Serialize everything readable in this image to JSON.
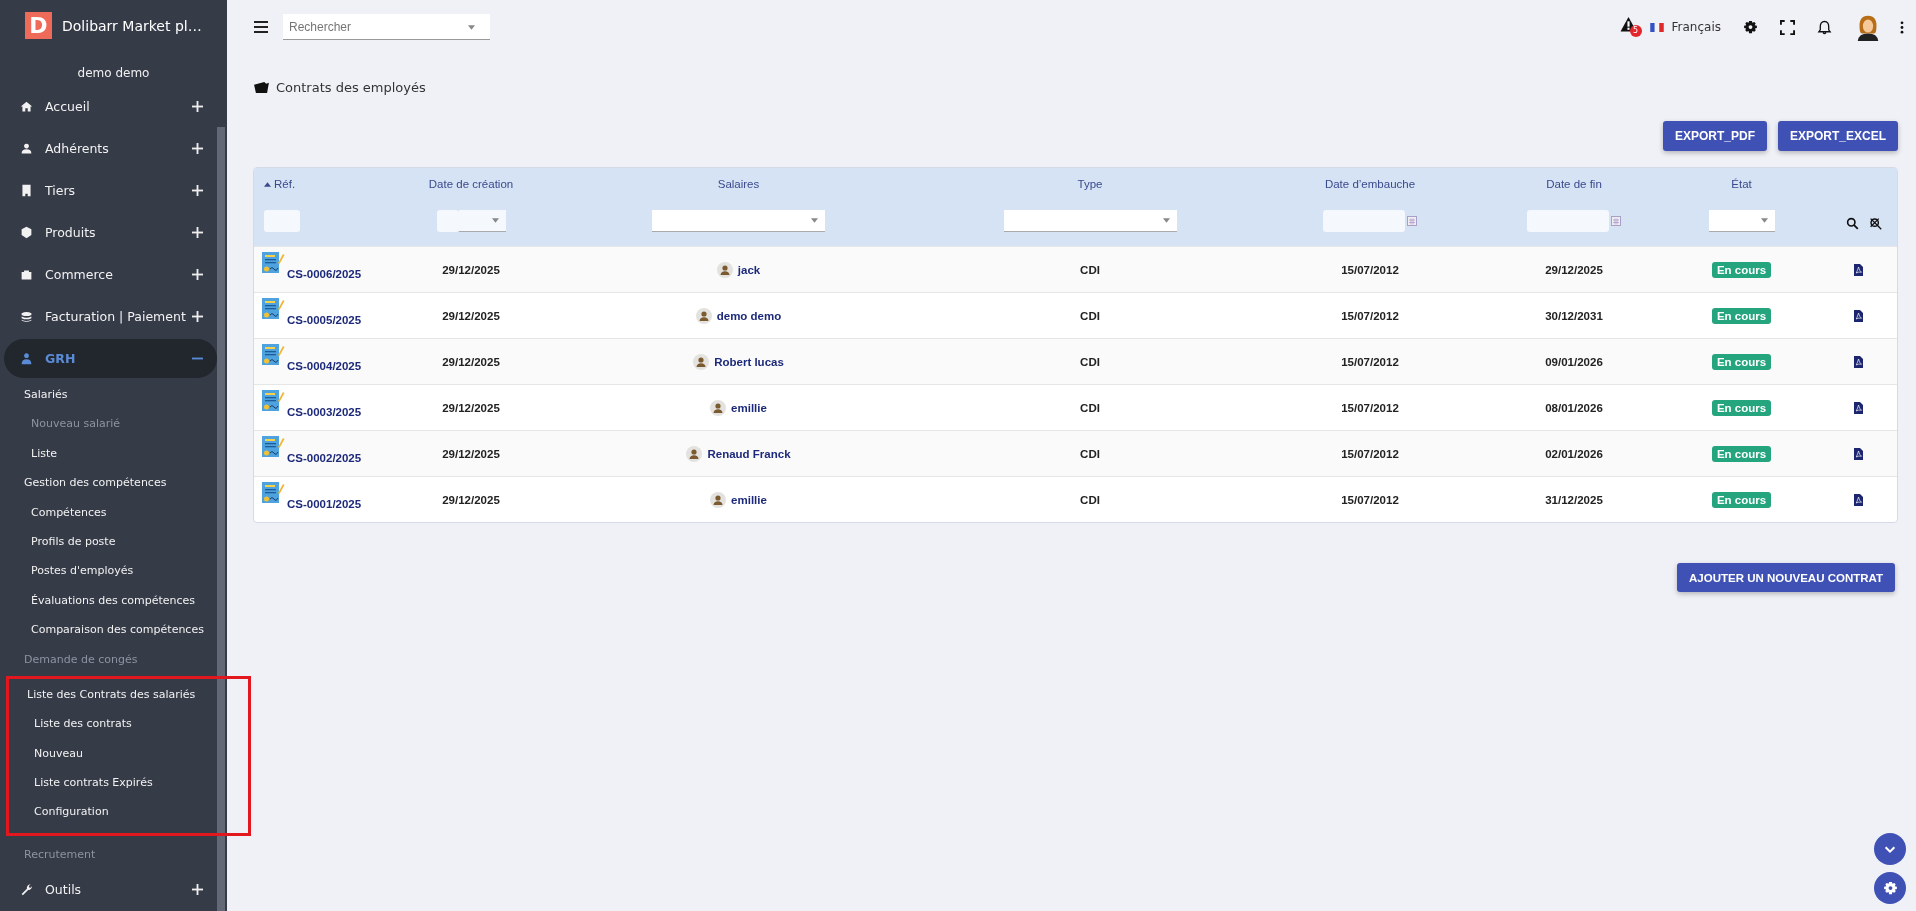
{
  "app": {
    "name": "Dolibarr Market pl…",
    "logo_letter": "D"
  },
  "sidebar": {
    "user": "demo demo",
    "menu": [
      {
        "label": "Accueil",
        "selected": false,
        "expanded": false
      },
      {
        "label": "Adhérents",
        "selected": false,
        "expanded": false
      },
      {
        "label": "Tiers",
        "selected": false,
        "expanded": false
      },
      {
        "label": "Produits",
        "selected": false,
        "expanded": false
      },
      {
        "label": "Commerce",
        "selected": false,
        "expanded": false
      },
      {
        "label": "Facturation | Paiement",
        "selected": false,
        "expanded": false
      },
      {
        "label": "GRH",
        "selected": true,
        "expanded": true,
        "children": [
          {
            "label": "Salariés",
            "disabled": false,
            "highlighted": false,
            "children": [
              {
                "label": "Nouveau salarié",
                "disabled": true
              },
              {
                "label": "Liste",
                "disabled": false
              }
            ]
          },
          {
            "label": "Gestion des compétences",
            "disabled": false,
            "highlighted": false,
            "children": [
              {
                "label": "Compétences",
                "disabled": false
              },
              {
                "label": "Profils de poste",
                "disabled": false
              },
              {
                "label": "Postes d'employés",
                "disabled": false
              },
              {
                "label": "Évaluations des compétences",
                "disabled": false
              },
              {
                "label": "Comparaison des compétences",
                "disabled": false
              }
            ]
          },
          {
            "label": "Demande de congés",
            "disabled": true,
            "highlighted": false
          },
          {
            "label": "Liste des Contrats des salariés",
            "disabled": false,
            "highlighted": true,
            "children": [
              {
                "label": "Liste des contrats",
                "disabled": false
              },
              {
                "label": "Nouveau",
                "disabled": false
              },
              {
                "label": "Liste contrats Expirés",
                "disabled": false
              },
              {
                "label": "Configuration",
                "disabled": false
              }
            ]
          },
          {
            "label": "Recrutement",
            "disabled": true,
            "highlighted": false
          }
        ]
      },
      {
        "label": "Outils",
        "selected": false,
        "expanded": false
      }
    ]
  },
  "topbar": {
    "search": {
      "placeholder": "Rechercher"
    },
    "alert_count": "5",
    "language": "Français"
  },
  "page": {
    "title": "Contrats des employés",
    "export_buttons": [
      "EXPORT_PDF",
      "EXPORT_EXCEL"
    ],
    "add_button": "AJOUTER UN NOUVEAU CONTRAT"
  },
  "table": {
    "columns": [
      {
        "label": "Réf.",
        "sorted": true,
        "kind": "text"
      },
      {
        "label": "Date de création",
        "sorted": false,
        "kind": "dateselect"
      },
      {
        "label": "Salaires",
        "sorted": false,
        "kind": "select"
      },
      {
        "label": "Type",
        "sorted": false,
        "kind": "select"
      },
      {
        "label": "Date d’embauche",
        "sorted": false,
        "kind": "date"
      },
      {
        "label": "Date de fin",
        "sorted": false,
        "kind": "date"
      },
      {
        "label": "État",
        "sorted": false,
        "kind": "selectsmall"
      }
    ],
    "rows": [
      {
        "ref": "CS-0006/2025",
        "created": "29/12/2025",
        "employee": "jack",
        "type": "CDI",
        "hired": "15/07/2012",
        "end": "29/12/2025",
        "status": "En cours"
      },
      {
        "ref": "CS-0005/2025",
        "created": "29/12/2025",
        "employee": "demo demo",
        "type": "CDI",
        "hired": "15/07/2012",
        "end": "30/12/2031",
        "status": "En cours"
      },
      {
        "ref": "CS-0004/2025",
        "created": "29/12/2025",
        "employee": "Robert lucas",
        "type": "CDI",
        "hired": "15/07/2012",
        "end": "09/01/2026",
        "status": "En cours"
      },
      {
        "ref": "CS-0003/2025",
        "created": "29/12/2025",
        "employee": "emillie",
        "type": "CDI",
        "hired": "15/07/2012",
        "end": "08/01/2026",
        "status": "En cours"
      },
      {
        "ref": "CS-0002/2025",
        "created": "29/12/2025",
        "employee": "Renaud Franck",
        "type": "CDI",
        "hired": "15/07/2012",
        "end": "02/01/2026",
        "status": "En cours"
      },
      {
        "ref": "CS-0001/2025",
        "created": "29/12/2025",
        "employee": "emillie",
        "type": "CDI",
        "hired": "15/07/2012",
        "end": "31/12/2025",
        "status": "En cours"
      }
    ]
  }
}
